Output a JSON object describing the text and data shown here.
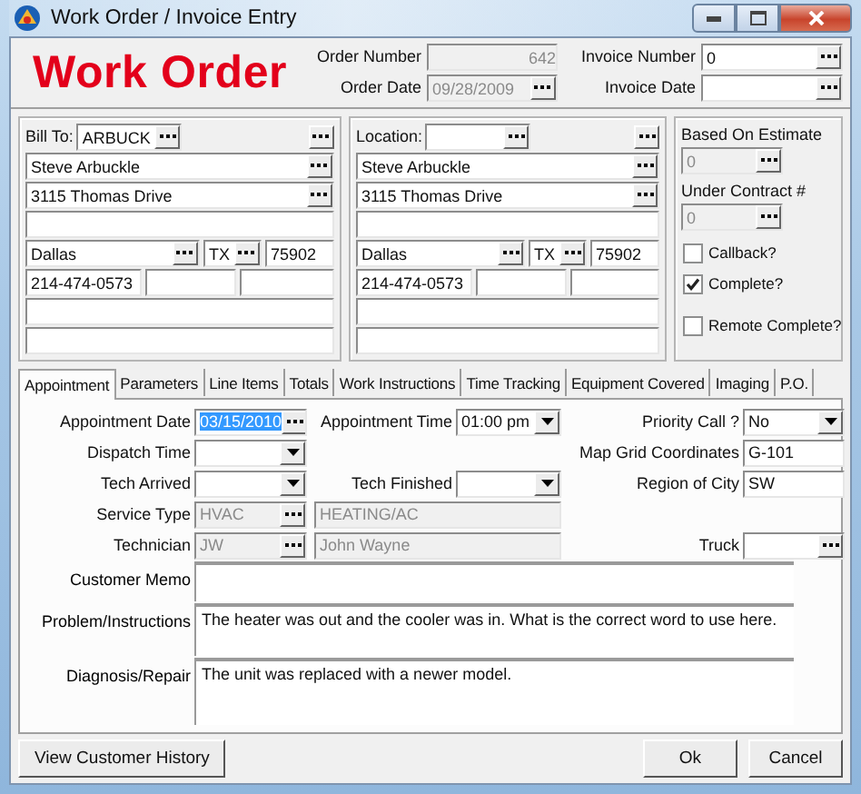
{
  "window": {
    "title": "Work Order / Invoice Entry"
  },
  "header": {
    "title": "Work Order",
    "fields": [
      {
        "label": "Order Number",
        "value": "642",
        "disabled": true,
        "lookup": false
      },
      {
        "label": "Invoice Number",
        "value": "0",
        "disabled": false,
        "lookup": true
      },
      {
        "label": "Order Date",
        "value": "09/28/2009",
        "disabled": true,
        "lookup": true
      },
      {
        "label": "Invoice Date",
        "disabled": false,
        "lookup": true
      }
    ]
  },
  "bill_to": {
    "label": "Bill To:",
    "code": "ARBUCK",
    "name": "Steve Arbuckle",
    "street": "3115 Thomas Drive",
    "city": "Dallas",
    "state": "TX",
    "zip": "75902",
    "phone": "214-474-0573"
  },
  "location": {
    "label": "Location:",
    "name": "Steve Arbuckle",
    "street": "3115 Thomas Drive",
    "city": "Dallas",
    "state": "TX",
    "zip": "75902",
    "phone": "214-474-0573"
  },
  "contract": {
    "fields": [
      {
        "label": "Based On Estimate",
        "value": "0"
      },
      {
        "label": "Under Contract #",
        "value": "0"
      }
    ],
    "checkboxes": [
      {
        "label": "Callback?",
        "checked": false
      },
      {
        "label": "Complete?",
        "checked": true
      },
      {
        "label": "Remote Complete?",
        "checked": false
      }
    ]
  },
  "tabs": [
    {
      "label": "Appointment",
      "selected": true
    },
    {
      "label": "Parameters",
      "selected": false
    },
    {
      "label": "Line Items",
      "selected": false
    },
    {
      "label": "Totals",
      "selected": false
    },
    {
      "label": "Work Instructions",
      "selected": false
    },
    {
      "label": "Time Tracking",
      "selected": false
    },
    {
      "label": "Equipment Covered",
      "selected": false
    },
    {
      "label": "Imaging",
      "selected": false
    },
    {
      "label": "P.O.",
      "selected": false
    }
  ],
  "appointment": {
    "fields": [
      {
        "label": "Appointment Date",
        "kind": "lookup",
        "value": "03/15/2010",
        "text_selected": true,
        "disabled": false
      },
      {
        "label": "Appointment Time",
        "kind": "dropdown",
        "value": "01:00 pm",
        "disabled": false
      },
      {
        "label": "Priority Call ?",
        "kind": "dropdown",
        "value": "No",
        "disabled": false
      },
      {
        "label": "Dispatch Time",
        "kind": "dropdown",
        "disabled": false
      },
      {
        "label": "Map Grid Coordinates",
        "kind": "text",
        "value": "G-101",
        "disabled": false
      },
      {
        "label": "Tech Arrived",
        "kind": "dropdown",
        "disabled": false
      },
      {
        "label": "Tech Finished",
        "kind": "dropdown",
        "disabled": false
      },
      {
        "label": "Region of City",
        "kind": "text",
        "value": "SW",
        "disabled": false
      },
      {
        "label": "Service Type",
        "kind": "lookup",
        "value": "HVAC",
        "description": "HEATING/AC",
        "disabled": true
      },
      {
        "label": "Technician",
        "kind": "lookup",
        "value": "JW",
        "description": "John Wayne",
        "disabled": true
      },
      {
        "label": "Truck",
        "kind": "lookup",
        "disabled": false
      }
    ],
    "memos": [
      {
        "label": "Customer Memo"
      },
      {
        "label": "Problem/Instructions",
        "value": "The heater was out and the cooler was in. What is the correct word to use here."
      },
      {
        "label": "Diagnosis/Repair",
        "value": "The unit was replaced with a newer model."
      }
    ]
  },
  "footer": {
    "left_button": "View Customer History",
    "right_buttons": [
      "Ok",
      "Cancel"
    ]
  }
}
